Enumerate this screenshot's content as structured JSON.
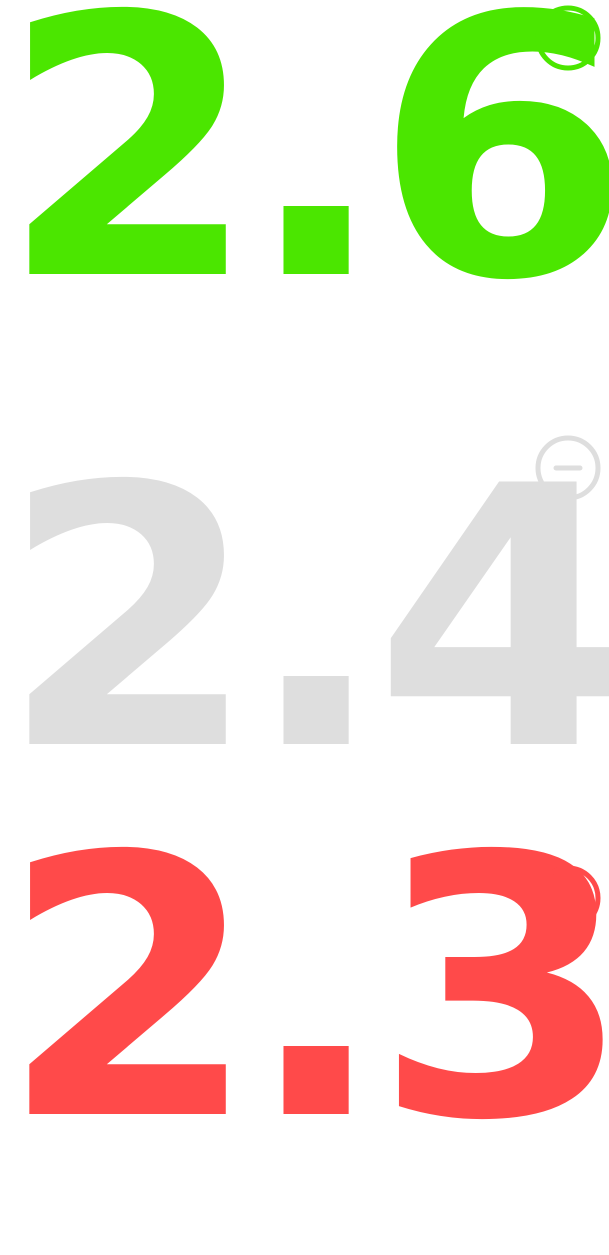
{
  "metrics": [
    {
      "value": "2.6",
      "trend": "up",
      "icon": "chevron-up-circle-icon",
      "color": "#4be600"
    },
    {
      "value": "2.4",
      "trend": "flat",
      "icon": "minus-circle-icon",
      "color": "#dedede"
    },
    {
      "value": "2.3",
      "trend": "down",
      "icon": "chevron-down-circle-icon",
      "color": "#ff4a4a"
    }
  ]
}
